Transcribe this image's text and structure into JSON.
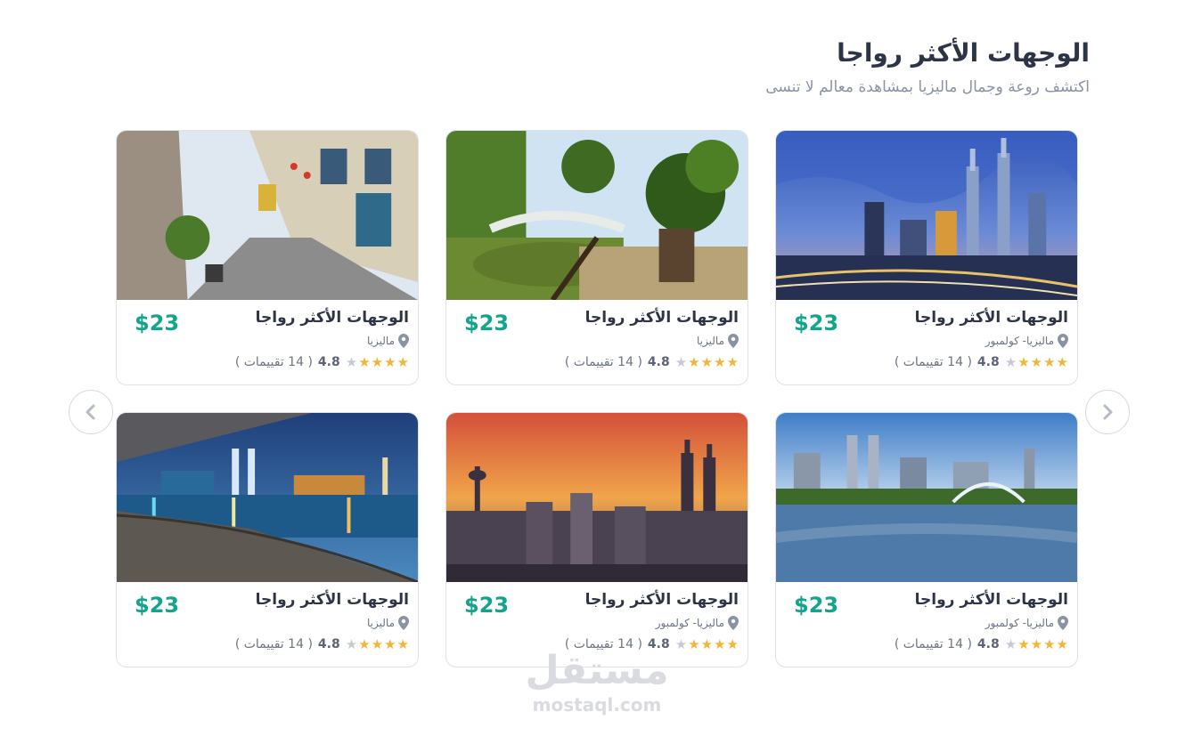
{
  "header": {
    "title": "الوجهات الأكثر رواجا",
    "subtitle": "اكتشف روعة وجمال ماليزيا بمشاهدة معالم لا تنسى"
  },
  "nav": {
    "next_icon": "chevron-right-icon",
    "prev_icon": "chevron-left-icon"
  },
  "cards": [
    {
      "title": "الوجهات الأكثر رواجا",
      "price": "$23",
      "location": "ماليزيا- كولمبور",
      "rating": "4.8",
      "reviews": "( 14 تقييمات )",
      "stars": 4,
      "image": "petronas-twin-towers-night"
    },
    {
      "title": "الوجهات الأكثر رواجا",
      "price": "$23",
      "location": "ماليزيا",
      "rating": "4.8",
      "reviews": "( 14 تقييمات )",
      "stars": 4,
      "image": "garden-bridge-pond"
    },
    {
      "title": "الوجهات الأكثر رواجا",
      "price": "$23",
      "location": "ماليزيا",
      "rating": "4.8",
      "reviews": "( 14 تقييمات )",
      "stars": 4,
      "image": "old-town-street"
    },
    {
      "title": "الوجهات الأكثر رواجا",
      "price": "$23",
      "location": "ماليزيا- كولمبور",
      "rating": "4.8",
      "reviews": "( 14 تقييمات )",
      "stars": 4,
      "image": "city-lake-fountain"
    },
    {
      "title": "الوجهات الأكثر رواجا",
      "price": "$23",
      "location": "ماليزيا- كولمبور",
      "rating": "4.8",
      "reviews": "( 14 تقييمات )",
      "stars": 4,
      "image": "skyline-sunset"
    },
    {
      "title": "الوجهات الأكثر رواجا",
      "price": "$23",
      "location": "ماليزيا",
      "rating": "4.8",
      "reviews": "( 14 تقييمات )",
      "stars": 4,
      "image": "waterfront-night-lights"
    }
  ],
  "watermark": {
    "arabic": "مستقل",
    "latin": "mostaql.com"
  },
  "colors": {
    "price": "#14a38b",
    "star_on": "#f5b433",
    "star_off": "#c5cad4",
    "title": "#2d3446"
  }
}
